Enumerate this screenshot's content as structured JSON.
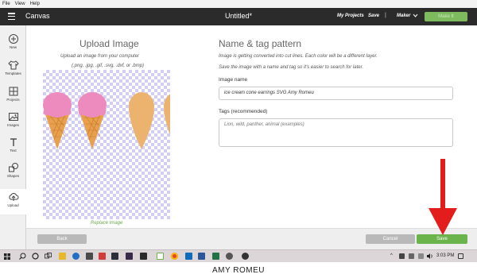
{
  "menubar": {
    "items": [
      "File",
      "View",
      "Help"
    ]
  },
  "header": {
    "app_title": "Canvas",
    "doc_title": "Untitled*",
    "my_projects": "My Projects",
    "save": "Save",
    "separator": "|",
    "machine": "Maker",
    "make_it": "Make It"
  },
  "sidebar": {
    "items": [
      {
        "label": "New",
        "icon": "plus-icon"
      },
      {
        "label": "Templates",
        "icon": "shirt-icon"
      },
      {
        "label": "Projects",
        "icon": "grid-icon"
      },
      {
        "label": "Images",
        "icon": "image-icon"
      },
      {
        "label": "Text",
        "icon": "text-icon"
      },
      {
        "label": "Shapes",
        "icon": "shapes-icon"
      },
      {
        "label": "Upload",
        "icon": "upload-icon"
      }
    ]
  },
  "upload": {
    "title": "Upload Image",
    "description": "Upload an image from your computer",
    "formats": "(.png, .jpg, .gif, .svg, .dxf, or .bmp)",
    "replace_link": "Replace Image"
  },
  "tag_pattern": {
    "title": "Name & tag pattern",
    "desc1": "Image is getting converted into cut lines. Each color will be a different layer.",
    "desc2": "Save the image with a name and tag so it's easier to search for later.",
    "name_label": "Image name",
    "name_value": "ice cream cone earrings SVG Amy Romeu",
    "tags_label": "Tags (recommended)",
    "tags_placeholder": "Lion, wild, panther, animal (examples)"
  },
  "footer": {
    "back": "Back",
    "cancel": "Cancel",
    "save": "Save"
  },
  "colors": {
    "accent_green": "#6bb34b",
    "arrow_red": "#e31c1c",
    "header_dark": "#2b2b2b",
    "scoop_pink": "#ee8bbe",
    "scoop_orange": "#ecb36f",
    "cone": "#e8a04d"
  },
  "taskbar": {
    "icons": [
      "windows-icon",
      "search-icon",
      "cortana-icon",
      "task-view-icon",
      "file-explorer-icon",
      "edge-icon",
      "calculator-icon",
      "store-icon",
      "photoshop-icon",
      "media-icon",
      "app-icon",
      "design-space-icon",
      "chrome-icon",
      "outlook-icon",
      "word-icon",
      "excel-icon",
      "app-icon"
    ],
    "time": "3:03 PM"
  },
  "caption": "AMY ROMEU"
}
